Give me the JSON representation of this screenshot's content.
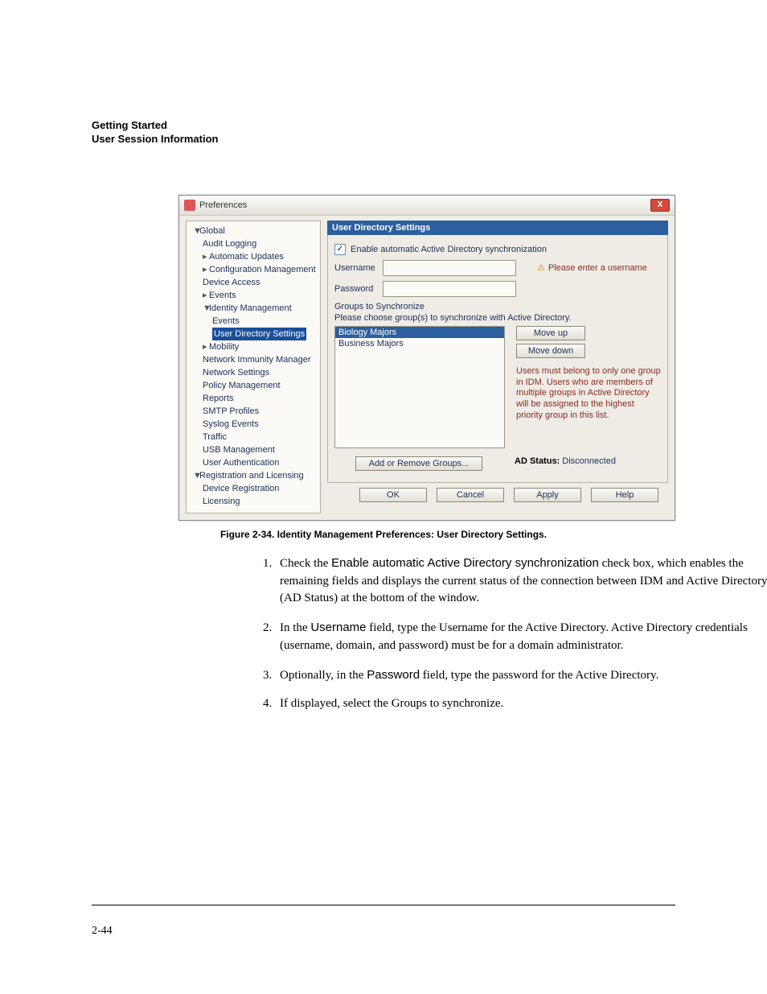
{
  "header": {
    "line1": "Getting Started",
    "line2": "User Session Information"
  },
  "dialog": {
    "title": "Preferences",
    "close_label": "X",
    "tree": {
      "n0": "Global",
      "n1": "Audit Logging",
      "n2": "Automatic Updates",
      "n3": "Configuration Management",
      "n4": "Device Access",
      "n5": "Events",
      "n6": "Identity Management",
      "n7": "Events",
      "n8": "User Directory Settings",
      "n9": "Mobility",
      "n10": "Network Immunity Manager",
      "n11": "Network Settings",
      "n12": "Policy Management",
      "n13": "Reports",
      "n14": "SMTP Profiles",
      "n15": "Syslog Events",
      "n16": "Traffic",
      "n17": "USB Management",
      "n18": "User Authentication",
      "n19": "Registration and Licensing",
      "n20": "Device Registration",
      "n21": "Licensing"
    },
    "panel_title": "User Directory Settings",
    "enable_label": "Enable automatic Active Directory synchronization",
    "username_label": "Username",
    "password_label": "Password",
    "username_warning": "Please enter a username",
    "groups_label": "Groups to Synchronize",
    "groups_help": "Please choose group(s) to synchronize with Active Directory.",
    "group_items": {
      "g0": "Biology Majors",
      "g1": "Business Majors"
    },
    "moveup": "Move up",
    "movedown": "Move down",
    "priority_note": "Users must belong to only one group in IDM. Users who are members of multiple groups in Active Directory will be assigned to the highest priority group in this list.",
    "add_remove": "Add or Remove Groups...",
    "ad_status_label": "AD Status:",
    "ad_status_value": "Disconnected",
    "buttons": {
      "ok": "OK",
      "cancel": "Cancel",
      "apply": "Apply",
      "help": "Help"
    }
  },
  "caption": "Figure 2-34. Identity Management Preferences: User Directory Settings.",
  "steps": {
    "s1a": "Check the ",
    "s1b": "Enable automatic Active Directory synchronization",
    "s1c": " check box, which enables the remaining fields and displays the current status of the connection between IDM and Active Directory (AD Status) at the bottom of the window.",
    "s2a": "In the ",
    "s2b": "Username",
    "s2c": " field, type the Username for the Active Directory. Active Directory credentials (username, domain, and password) must be for a domain administrator.",
    "s3a": "Optionally, in the ",
    "s3b": "Password",
    "s3c": " field, type the password for the Active Directory.",
    "s4": "If displayed, select the Groups to synchronize."
  },
  "page_number": "2-44"
}
